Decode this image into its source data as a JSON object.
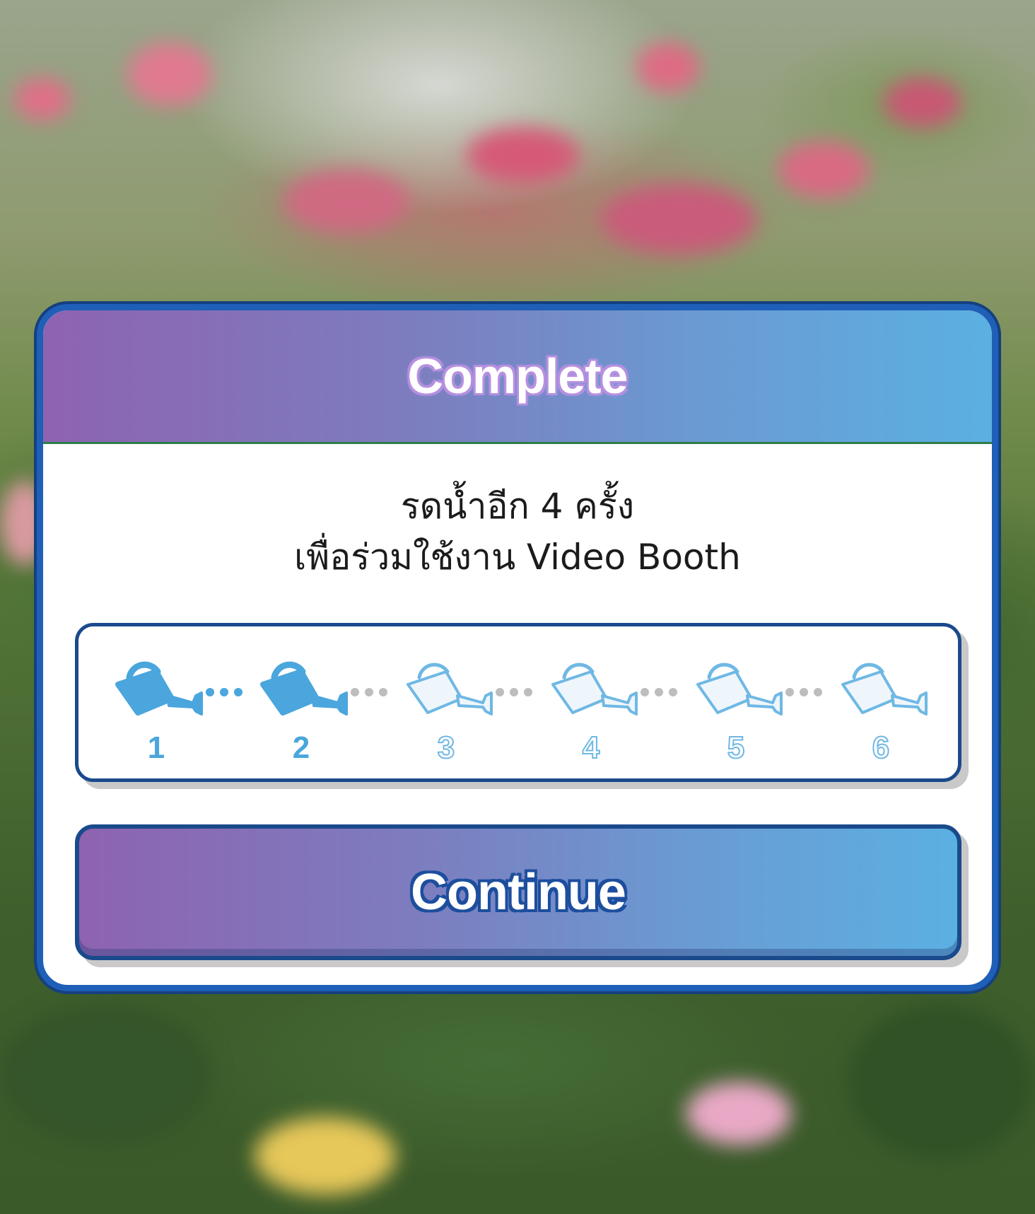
{
  "dialog": {
    "title": "Complete",
    "message_line1": "รดน้ำอีก 4 ครั้ง",
    "message_line2": "เพื่อร่วมใช้งาน Video Booth",
    "continue_label": "Continue"
  },
  "progress": {
    "completed": 2,
    "total": 6,
    "steps": [
      {
        "number": "1",
        "state": "filled",
        "icon": "watering-can-icon"
      },
      {
        "number": "2",
        "state": "filled",
        "icon": "watering-can-icon"
      },
      {
        "number": "3",
        "state": "empty",
        "icon": "watering-can-outline-icon"
      },
      {
        "number": "4",
        "state": "empty",
        "icon": "watering-can-outline-icon"
      },
      {
        "number": "5",
        "state": "empty",
        "icon": "watering-can-outline-icon"
      },
      {
        "number": "6",
        "state": "empty",
        "icon": "watering-can-outline-icon"
      }
    ]
  },
  "colors": {
    "accent_blue": "#4aa6dc",
    "border_navy": "#1a4a8c",
    "gradient_purple": "#8e63b0",
    "gradient_blue": "#5bb0e2",
    "inactive_dot": "#bdbdbd"
  }
}
